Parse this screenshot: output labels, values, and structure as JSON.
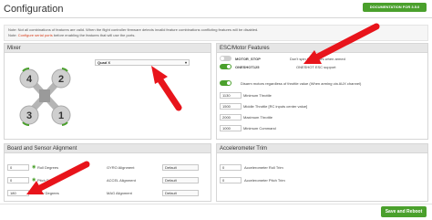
{
  "header": {
    "title": "Configuration",
    "doc_button": "DOCUMENTATION FOR 3.5.0"
  },
  "note": {
    "line1": "Note: Not all combinations of features are valid. When the flight controller firmware detects invalid feature combinations conflicting features will be disabled.",
    "line2_pre": "Note:",
    "line2_link": "Configure serial ports",
    "line2_post": "before enabling the features that will use the ports."
  },
  "mixer": {
    "heading": "Mixer",
    "selected": "Quad X",
    "motors": [
      "4",
      "2",
      "3",
      "1"
    ]
  },
  "esc": {
    "heading": "ESC/Motor Features",
    "features": [
      {
        "toggle_on": false,
        "name": "MOTOR_STOP",
        "desc": "Don't spin the motors when armed"
      },
      {
        "toggle_on": true,
        "name": "ONESHOT125",
        "desc": "ONESHOT ESC support"
      },
      {
        "toggle_on": true,
        "name": "",
        "desc": "Disarm motors regardless of throttle value (When arming via AUX channel)"
      }
    ],
    "values": [
      {
        "value": "1130",
        "label": "Minimum Throttle"
      },
      {
        "value": "1500",
        "label": "Middle Throttle [RC inputs center value]"
      },
      {
        "value": "2000",
        "label": "Maximum Throttle"
      },
      {
        "value": "1000",
        "label": "Minimum Command"
      }
    ]
  },
  "board": {
    "heading": "Board and Sensor Alignment",
    "degrees": [
      {
        "value": "0",
        "label": "Roll Degrees"
      },
      {
        "value": "0",
        "label": "Pitch Degrees"
      },
      {
        "value": "180",
        "label": "Yaw Degrees"
      }
    ],
    "alignments": [
      {
        "label": "GYRO Alignment",
        "value": "Default"
      },
      {
        "label": "ACCEL Alignment",
        "value": "Default"
      },
      {
        "label": "MAG Alignment",
        "value": "Default"
      }
    ]
  },
  "accel": {
    "heading": "Accelerometer Trim",
    "rows": [
      {
        "value": "0",
        "label": "Accelerometer Roll Trim"
      },
      {
        "value": "0",
        "label": "Accelerometer Pitch Trim"
      }
    ]
  },
  "footer": {
    "save_button": "Save and Reboot"
  },
  "colors": {
    "accent_green": "#4aa02c",
    "arrow_red": "#e8141b",
    "motor_grey": "#b5b5b5"
  }
}
